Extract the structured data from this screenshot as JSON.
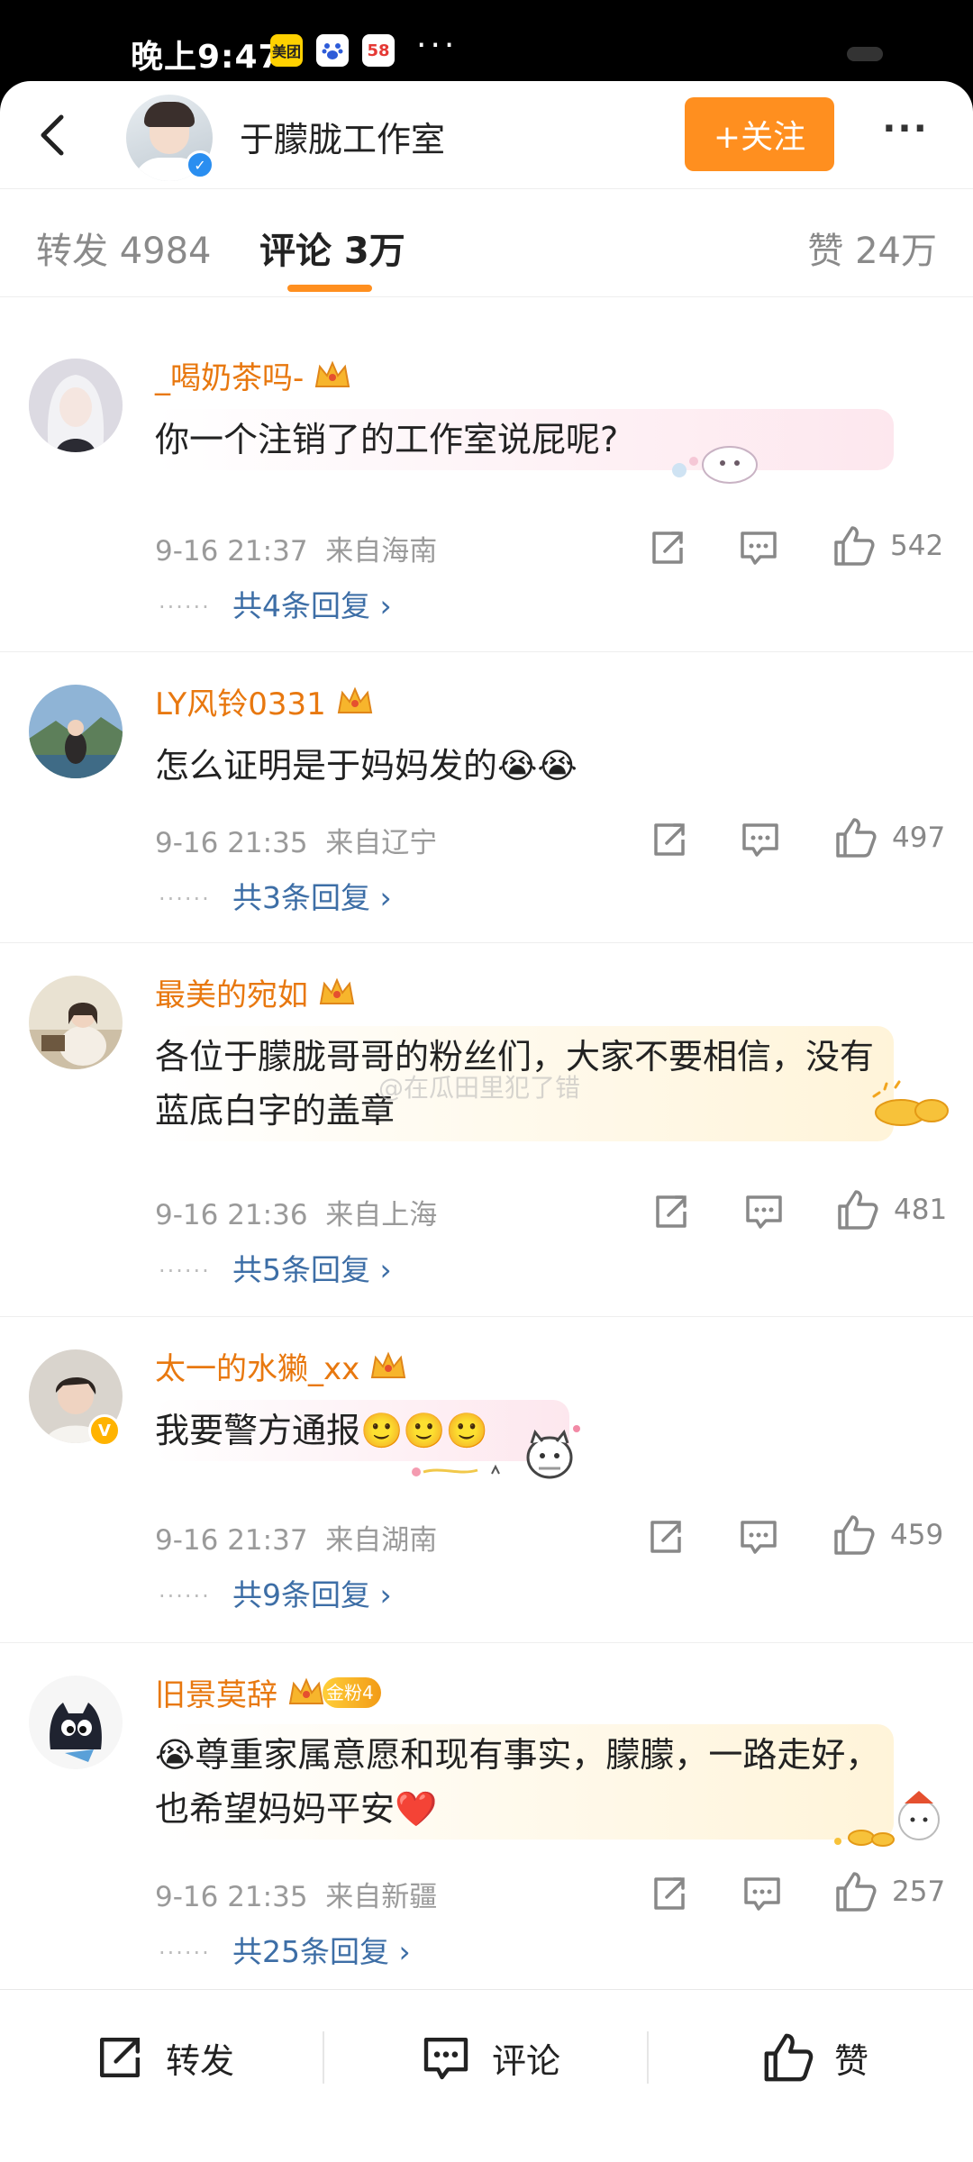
{
  "status_bar": {
    "time": "晚上9:47",
    "apps": [
      "美团",
      "百度",
      "58"
    ],
    "dots": "···"
  },
  "header": {
    "title": "于朦胧工作室",
    "follow_label": "+关注",
    "more_label": "···"
  },
  "tabs": {
    "repost": "转发 4984",
    "comments": "评论 3万",
    "likes": "赞 24万",
    "active": "comments"
  },
  "comments": [
    {
      "username": "_喝奶茶吗-",
      "text": "你一个注销了的工作室说屁呢?",
      "time": "9-16 21:37",
      "location": "来自海南",
      "likes": "542",
      "replies": "共4条回复 ›"
    },
    {
      "username": "LY风铃0331",
      "text": "怎么证明是于妈妈发的😭😭",
      "time": "9-16 21:35",
      "location": "来自辽宁",
      "likes": "497",
      "replies": "共3条回复 ›"
    },
    {
      "username": "最美的宛如",
      "text": "各位于朦胧哥哥的粉丝们，大家不要相信，没有蓝底白字的盖章",
      "time": "9-16 21:36",
      "location": "来自上海",
      "likes": "481",
      "replies": "共5条回复 ›"
    },
    {
      "username": "太一的水獭_xx",
      "text": "我要警方通报🙂🙂🙂",
      "time": "9-16 21:37",
      "location": "来自湖南",
      "likes": "459",
      "replies": "共9条回复 ›"
    },
    {
      "username": "旧景莫辞",
      "fan_badge": "金粉4",
      "text": "😭尊重家属意愿和现有事实，朦朦，一路走好，也希望妈妈平安❤️",
      "time": "9-16 21:35",
      "location": "来自新疆",
      "likes": "257",
      "replies": "共25条回复 ›"
    }
  ],
  "watermark": "@在瓜田里犯了错",
  "bottom_bar": {
    "repost": "转发",
    "comment": "评论",
    "like": "赞"
  },
  "colors": {
    "accent": "#ff8f1f",
    "username": "#e8780f",
    "reply_link": "#3d6ea6",
    "verify": "#2a8ef0"
  }
}
